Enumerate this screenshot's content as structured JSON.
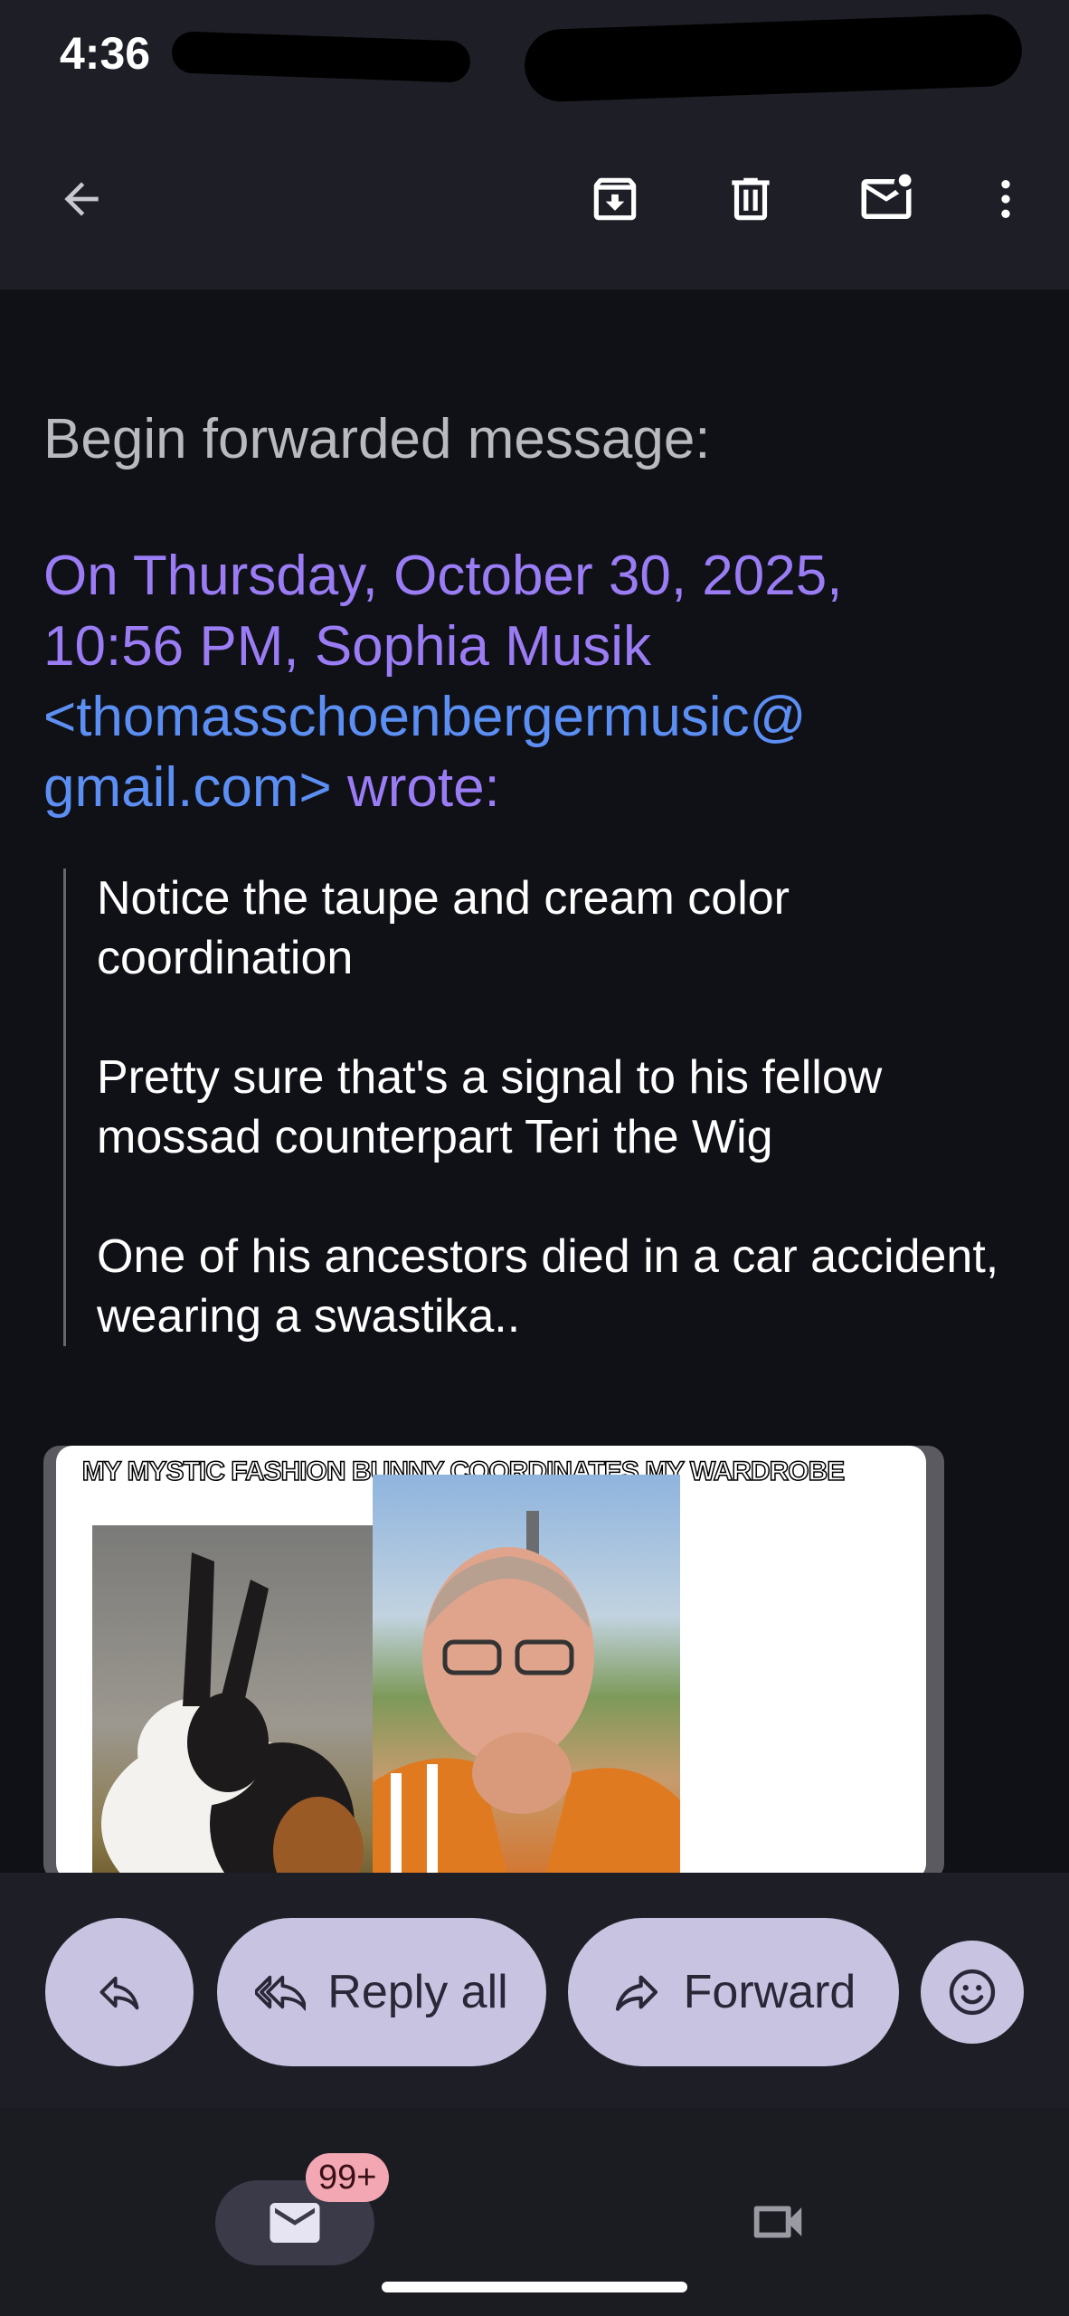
{
  "status_bar": {
    "time": "4:36"
  },
  "toolbar": {
    "icons": [
      "back-arrow-icon",
      "archive-icon",
      "delete-icon",
      "mark-unread-icon",
      "more-vert-icon"
    ]
  },
  "email": {
    "forward_title": "Begin forwarded message:",
    "header_prefix": "On Thursday, October 30, 2025, 10:56 PM, Sophia Musik ",
    "header_email": "<thomasschoenbergermusic@ gmail.com>",
    "header_suffix": " wrote:",
    "quoted_paragraphs": [
      "Notice the taupe and cream color coordination",
      "Pretty sure that's a signal to his fellow mossad counterpart Teri the Wig",
      "One of his ancestors died in a car accident, wearing a swastika.."
    ],
    "attachment_caption": "MY MYSTIC FASHION BUNNY COORDINATES MY WARDROBE"
  },
  "actions": {
    "reply_all": "Reply all",
    "forward": "Forward"
  },
  "nav": {
    "mail_badge": "99+"
  },
  "colors": {
    "background": "#101017",
    "bar": "#1e1f26",
    "pill": "#c8c3e0",
    "link_purple": "#9a7cf4",
    "link_blue": "#5c8ff3",
    "badge": "#f2a7b2"
  }
}
